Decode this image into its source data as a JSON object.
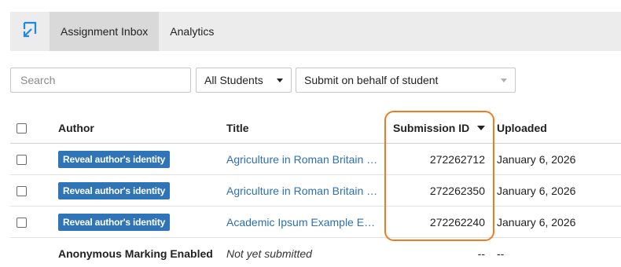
{
  "nav": {
    "logo_icon": "assignment-app-logo-icon",
    "tabs": [
      {
        "label": "Assignment Inbox",
        "active": true
      },
      {
        "label": "Analytics",
        "active": false
      }
    ]
  },
  "filters": {
    "search_placeholder": "Search",
    "students_select": "All Students",
    "submit_select": "Submit on behalf of student"
  },
  "table": {
    "headers": {
      "author": "Author",
      "title": "Title",
      "submission_id": "Submission ID",
      "uploaded": "Uploaded"
    },
    "rows": [
      {
        "author_button": "Reveal author's identity",
        "title": "Agriculture in Roman Britain …",
        "submission_id": "272262712",
        "uploaded": "January 6, 2026"
      },
      {
        "author_button": "Reveal author's identity",
        "title": "Agriculture in Roman Britain …",
        "submission_id": "272262350",
        "uploaded": "January 6, 2026"
      },
      {
        "author_button": "Reveal author's identity",
        "title": "Academic Ipsum Example Es…",
        "submission_id": "272262240",
        "uploaded": "January 6, 2026"
      }
    ],
    "footer_row": {
      "author": "Anonymous Marking Enabled",
      "title": "Not yet submitted",
      "submission_id": "--",
      "uploaded": "--"
    }
  },
  "colors": {
    "highlight": "#ef7b21",
    "link": "#2e6fad",
    "button": "#2f74b7"
  }
}
